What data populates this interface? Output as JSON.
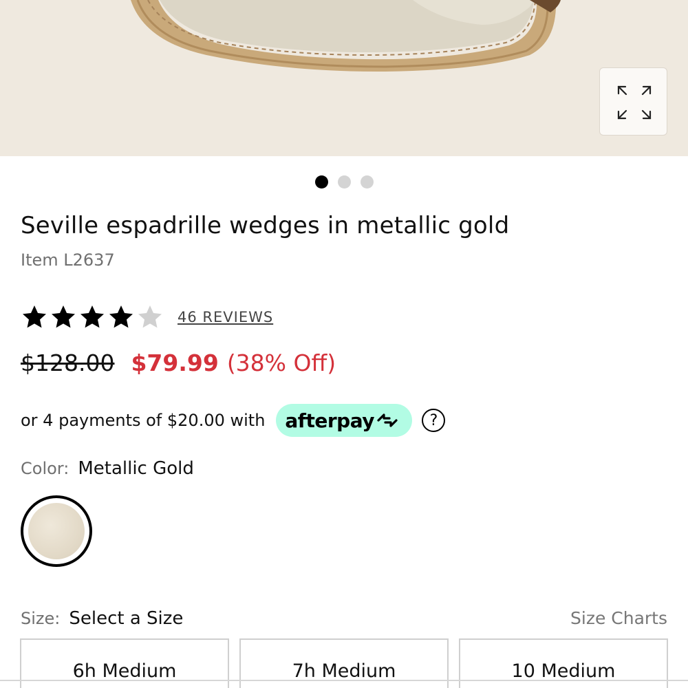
{
  "hero": {
    "image_alt": "Seville espadrille wedge product image",
    "zoom_icon": "expand-icon"
  },
  "carousel": {
    "total": 3,
    "active": 1
  },
  "product": {
    "title": "Seville espadrille wedges in metallic gold",
    "item": "Item L2637"
  },
  "rating": {
    "value": 4,
    "max": 5,
    "reviews_label": "46 REVIEWS"
  },
  "price": {
    "original": "$128.00",
    "sale": "$79.99",
    "discount": "(38% Off)"
  },
  "afterpay": {
    "text": "or 4 payments of $20.00 with",
    "brand": "afterpay",
    "help_symbol": "?"
  },
  "color": {
    "label": "Color:",
    "value": "Metallic Gold"
  },
  "size": {
    "label": "Size:",
    "value": "Select a Size",
    "charts_link": "Size Charts",
    "options": [
      "6h Medium",
      "7h Medium",
      "10 Medium"
    ]
  },
  "colors": {
    "sale_red": "#d4313a",
    "afterpay_mint": "#b2fce4",
    "star_filled": "#000000",
    "star_empty": "#d0d0d0"
  }
}
